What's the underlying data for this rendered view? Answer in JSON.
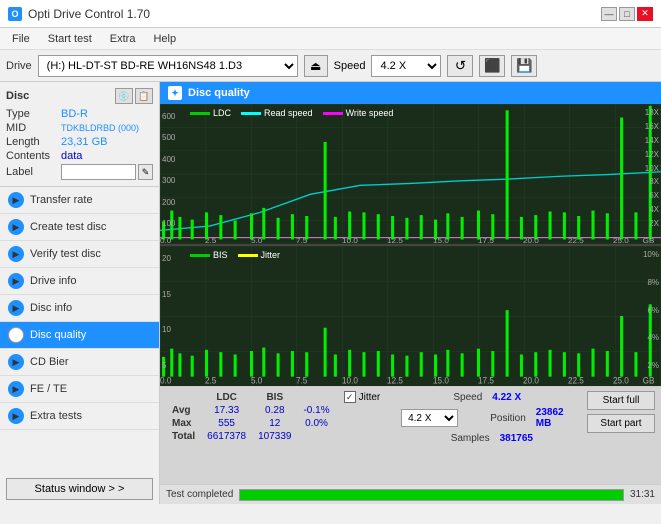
{
  "titlebar": {
    "title": "Opti Drive Control 1.70",
    "icon_label": "O",
    "min_btn": "—",
    "max_btn": "□",
    "close_btn": "✕"
  },
  "menubar": {
    "items": [
      "File",
      "Start test",
      "Extra",
      "Help"
    ]
  },
  "drivebar": {
    "label": "Drive",
    "drive_value": "(H:)  HL-DT-ST BD-RE  WH16NS48 1.D3",
    "eject_icon": "⏏",
    "speed_label": "Speed",
    "speed_value": "4.2 X",
    "icon1": "↺",
    "icon2": "⬛",
    "icon3": "💾"
  },
  "sidebar": {
    "disc_label": "Disc",
    "disc_fields": [
      {
        "key": "Type",
        "val": "BD-R",
        "color": "blue"
      },
      {
        "key": "MID",
        "val": "TDKBLDRBD (000)",
        "color": "blue"
      },
      {
        "key": "Length",
        "val": "23,31 GB",
        "color": "blue"
      },
      {
        "key": "Contents",
        "val": "data",
        "color": "blue"
      },
      {
        "key": "Label",
        "val": "",
        "color": "normal"
      }
    ],
    "menu_items": [
      {
        "id": "transfer-rate",
        "label": "Transfer rate",
        "active": false
      },
      {
        "id": "create-test-disc",
        "label": "Create test disc",
        "active": false
      },
      {
        "id": "verify-test-disc",
        "label": "Verify test disc",
        "active": false
      },
      {
        "id": "drive-info",
        "label": "Drive info",
        "active": false
      },
      {
        "id": "disc-info",
        "label": "Disc info",
        "active": false
      },
      {
        "id": "disc-quality",
        "label": "Disc quality",
        "active": true
      },
      {
        "id": "cd-bier",
        "label": "CD Bier",
        "active": false
      },
      {
        "id": "fe-te",
        "label": "FE / TE",
        "active": false
      },
      {
        "id": "extra-tests",
        "label": "Extra tests",
        "active": false
      }
    ],
    "status_btn": "Status window > >"
  },
  "content": {
    "header": "Disc quality",
    "chart_top": {
      "legend": [
        {
          "id": "ldc",
          "label": "LDC",
          "color": "#00cc00"
        },
        {
          "id": "read",
          "label": "Read speed",
          "color": "#00ffff"
        },
        {
          "id": "write",
          "label": "Write speed",
          "color": "#ff88ff"
        }
      ],
      "y_axis_right": [
        "18X",
        "16X",
        "14X",
        "12X",
        "10X",
        "8X",
        "6X",
        "4X",
        "2X"
      ],
      "y_axis_left": [
        "600",
        "500",
        "400",
        "300",
        "200",
        "100"
      ],
      "x_axis": [
        "0.0",
        "2.5",
        "5.0",
        "7.5",
        "10.0",
        "12.5",
        "15.0",
        "17.5",
        "20.0",
        "22.5",
        "25.0"
      ],
      "x_label": "GB"
    },
    "chart_bottom": {
      "legend": [
        {
          "id": "bis",
          "label": "BIS",
          "color": "#00cc00"
        },
        {
          "id": "jitter",
          "label": "Jitter",
          "color": "#ffff00"
        }
      ],
      "y_axis_right": [
        "10%",
        "8%",
        "6%",
        "4%",
        "2%"
      ],
      "y_axis_left": [
        "20",
        "15",
        "10",
        "5"
      ],
      "x_axis": [
        "0.0",
        "2.5",
        "5.0",
        "7.5",
        "10.0",
        "12.5",
        "15.0",
        "17.5",
        "20.0",
        "22.5",
        "25.0"
      ],
      "x_label": "GB"
    },
    "stats": {
      "headers": [
        "LDC",
        "BIS"
      ],
      "rows": [
        {
          "label": "Avg",
          "ldc": "17.33",
          "bis": "0.28",
          "jitter_val": "-0.1%"
        },
        {
          "label": "Max",
          "ldc": "555",
          "bis": "12",
          "jitter_val": "0.0%"
        },
        {
          "label": "Total",
          "ldc": "6617378",
          "bis": "107339",
          "jitter_val": ""
        }
      ],
      "jitter_label": "Jitter",
      "jitter_checked": true,
      "speed_label": "Speed",
      "speed_val": "4.22 X",
      "speed_sel": "4.2 X",
      "position_label": "Position",
      "position_val": "23862 MB",
      "samples_label": "Samples",
      "samples_val": "381765",
      "start_full_btn": "Start full",
      "start_part_btn": "Start part"
    },
    "progressbar": {
      "label": "Test completed",
      "percent": 100,
      "time": "31:31"
    }
  }
}
